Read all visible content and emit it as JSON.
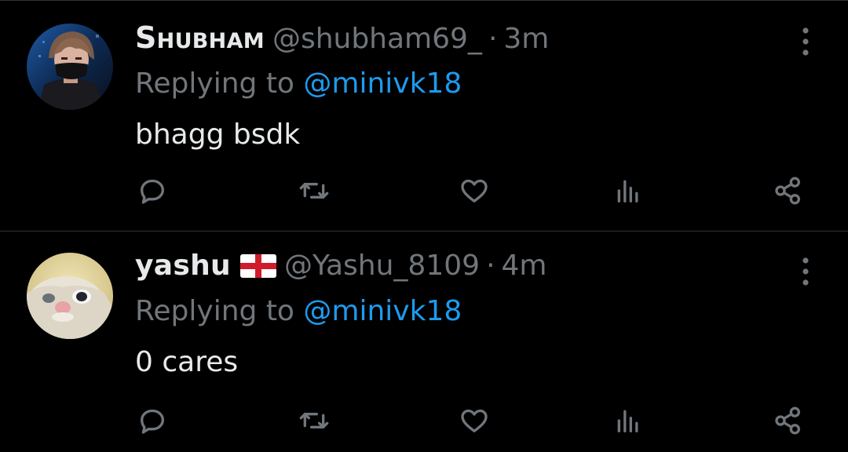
{
  "tweets": [
    {
      "display_name": "Shubham",
      "handle": "@shubham69_",
      "separator": "·",
      "time": "3m",
      "replying_prefix": "Replying to ",
      "replying_to": "@minivk18",
      "text": "bhagg bsdk",
      "avatar_icon": "avatar-masked-anime-character",
      "flag": null
    },
    {
      "display_name": "yashu",
      "handle": "@Yashu_8109",
      "separator": "·",
      "time": "4m",
      "replying_prefix": "Replying to ",
      "replying_to": "@minivk18",
      "text": "0 cares",
      "avatar_icon": "avatar-cat-face",
      "flag": "england-flag"
    }
  ],
  "actions": [
    "reply-icon",
    "retweet-icon",
    "like-icon",
    "views-icon",
    "share-icon"
  ],
  "colors": {
    "background": "#000000",
    "primary_text": "#e7e9ea",
    "secondary_text": "#71767b",
    "link": "#1d9bf0",
    "divider": "#2f3336"
  }
}
